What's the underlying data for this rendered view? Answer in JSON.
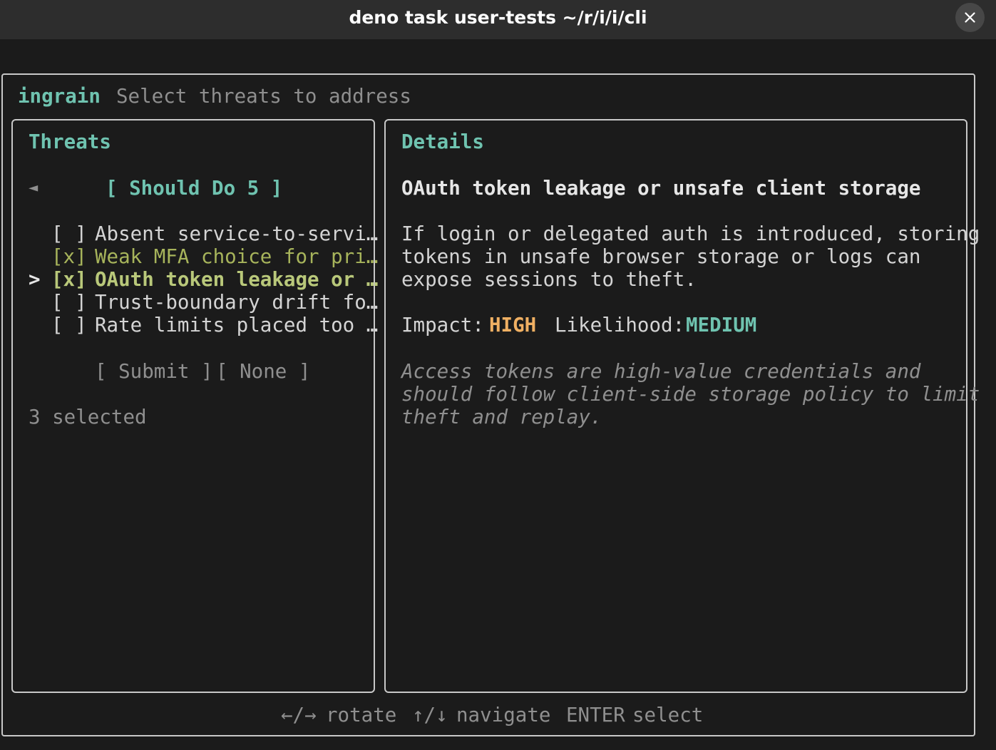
{
  "window": {
    "title": "deno task user-tests ~/r/i/i/cli",
    "close_icon": "close-icon"
  },
  "header": {
    "app_name": "ingrain",
    "prompt": "Select threats to address"
  },
  "threats_panel": {
    "title": "Threats",
    "group_arrow": "◄",
    "group_label": "[ Should Do 5 ]",
    "items": [
      {
        "cursor": "",
        "mark": "[ ]",
        "label": "Absent service-to-servi…",
        "checked": false,
        "active": false
      },
      {
        "cursor": "",
        "mark": "[x]",
        "label": "Weak MFA choice for pri…",
        "checked": true,
        "active": false
      },
      {
        "cursor": ">",
        "mark": "[x]",
        "label": "OAuth token leakage or …",
        "checked": true,
        "active": true
      },
      {
        "cursor": "",
        "mark": "[ ]",
        "label": "Trust-boundary drift fo…",
        "checked": false,
        "active": false
      },
      {
        "cursor": "",
        "mark": "[ ]",
        "label": "Rate limits placed too …",
        "checked": false,
        "active": false
      }
    ],
    "submit_label": "[ Submit ]",
    "none_label": "[ None ]",
    "selected_count": "3 selected"
  },
  "details_panel": {
    "title": "Details",
    "heading": "OAuth token leakage or unsafe client storage",
    "description_lines": [
      "If login or delegated auth is introduced, storing",
      "tokens in unsafe browser storage or logs can",
      "expose sessions to theft."
    ],
    "impact_label": "Impact:",
    "impact_value": "HIGH",
    "likelihood_label": "Likelihood:",
    "likelihood_value": "MEDIUM",
    "rationale_lines": [
      "Access tokens are high-value credentials and",
      "should follow client-side storage policy to limit",
      "theft and replay."
    ]
  },
  "footer": {
    "rotate_keys": "←/→",
    "rotate_label": "rotate",
    "navigate_keys": "↑/↓",
    "navigate_label": "navigate",
    "select_keys": "ENTER",
    "select_label": "select"
  },
  "colors": {
    "background": "#1b1b1b",
    "titlebar": "#2d2d2d",
    "accent_teal": "#6fc3b0",
    "checked_olive": "#a7b45b",
    "impact_high": "#f0b063",
    "muted": "#8f8f8f",
    "border": "#c8c8c8"
  }
}
